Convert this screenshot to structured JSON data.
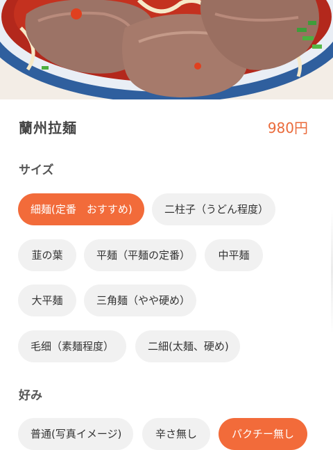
{
  "item": {
    "name": "蘭州拉麺",
    "price": "980円"
  },
  "colors": {
    "accent": "#f26b3a",
    "price": "#ea6a3a",
    "chip_bg": "#f1f1f1"
  },
  "size_section": {
    "label": "サイズ",
    "options": [
      {
        "label": "細麺(定番　おすすめ)",
        "selected": true
      },
      {
        "label": "二柱子（うどん程度）",
        "selected": false
      },
      {
        "label": "韮の葉",
        "selected": false
      },
      {
        "label": "平麺（平麺の定番）",
        "selected": false
      },
      {
        "label": "中平麺",
        "selected": false
      },
      {
        "label": "大平麺",
        "selected": false
      },
      {
        "label": "三角麺（やや硬め）",
        "selected": false
      },
      {
        "label": "毛细（素麺程度）",
        "selected": false
      },
      {
        "label": "二細(太麺、硬め)",
        "selected": false
      }
    ]
  },
  "preference_section": {
    "label": "好み",
    "options": [
      {
        "label": "普通(写真イメージ)",
        "selected": false
      },
      {
        "label": "辛さ無し",
        "selected": false
      },
      {
        "label": "パクチー無し",
        "selected": true
      }
    ]
  }
}
